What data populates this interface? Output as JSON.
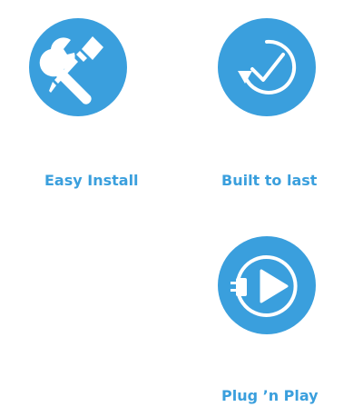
{
  "features": [
    {
      "label": "Easy Install",
      "icon": "wrench-screwdriver-icon"
    },
    {
      "label": "Built to last",
      "icon": "circular-checkmark-icon"
    },
    {
      "label": "Plug ’n Play",
      "icon": "plug-play-icon"
    }
  ],
  "colors": {
    "accent": "#3a9fdd",
    "icon_foreground": "#ffffff",
    "background": "#ffffff"
  }
}
